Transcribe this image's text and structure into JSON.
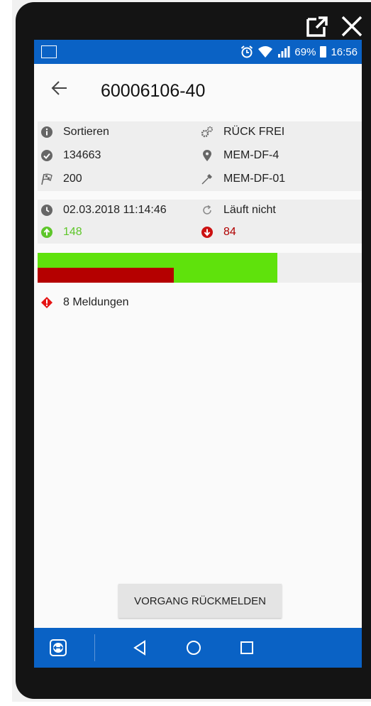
{
  "window": {
    "external_icon": "open-external-icon",
    "close_icon": "close-icon"
  },
  "statusbar": {
    "battery": "69%",
    "time": "16:56",
    "background": "#0a62c5"
  },
  "header": {
    "title": "60006106-40"
  },
  "info": {
    "status": "Sortieren",
    "feedback": "RÜCK FREI",
    "number": "134663",
    "location": "MEM-DF-4",
    "target": "200",
    "tool": "MEM-DF-01"
  },
  "timing": {
    "datetime": "02.03.2018 11:14:46",
    "state": "Läuft nicht",
    "good": "148",
    "bad": "84"
  },
  "progress": {
    "target": 200,
    "good": 148,
    "bad": 84,
    "good_color": "#5fe20c",
    "bad_color": "#b50000"
  },
  "messages": {
    "label": "8 Meldungen"
  },
  "action": {
    "label": "VORGANG RÜCKMELDEN"
  }
}
